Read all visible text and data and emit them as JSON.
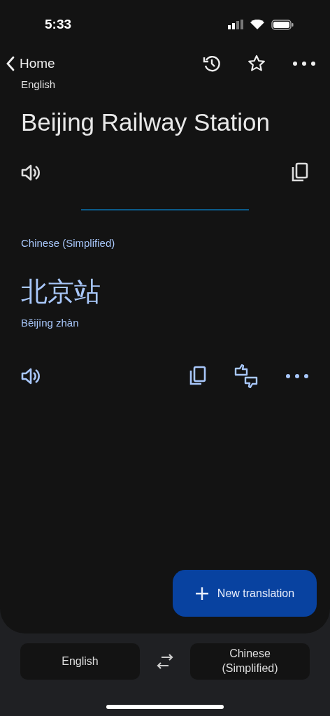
{
  "status_bar": {
    "time": "5:33"
  },
  "nav": {
    "back_label": "Home"
  },
  "source": {
    "language": "English",
    "text": "Beijing Railway Station"
  },
  "target": {
    "language": "Chinese (Simplified)",
    "text": "北京站",
    "romanization": "Běijīng zhàn"
  },
  "fab": {
    "label": "New translation"
  },
  "language_bar": {
    "source": "English",
    "target": "Chinese (Simplified)"
  }
}
